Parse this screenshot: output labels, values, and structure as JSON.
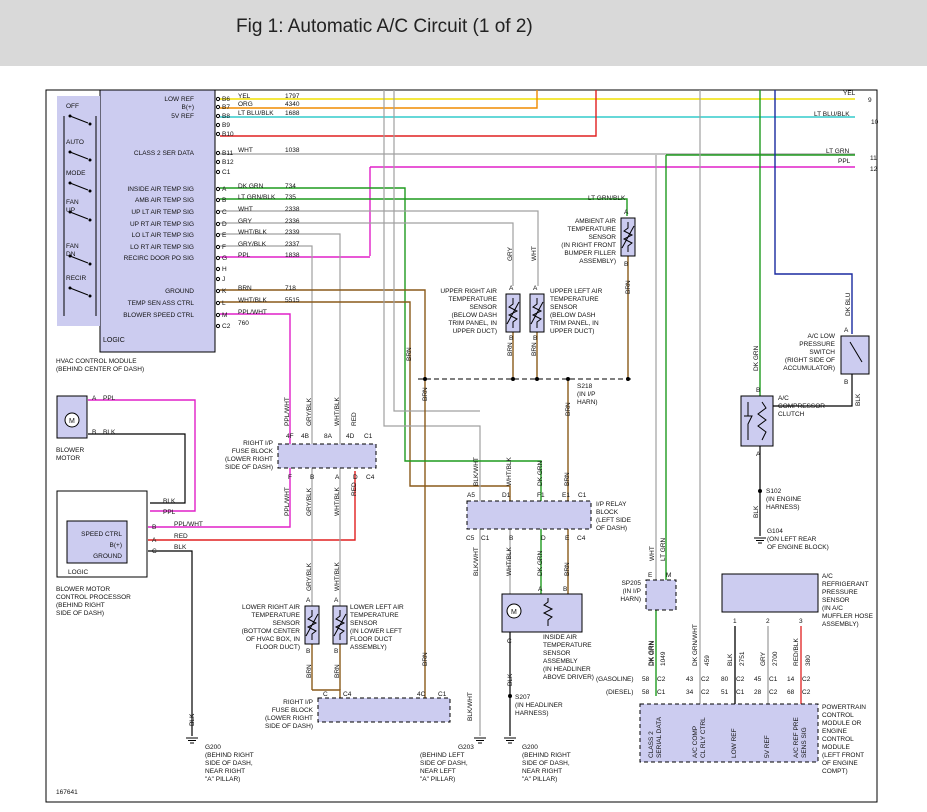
{
  "title": "Fig 1: Automatic A/C Circuit (1 of 2)",
  "figure_id": "167641",
  "hvac": {
    "name": "HVAC CONTROL MODULE",
    "location": "(BEHIND CENTER OF DASH)",
    "logic": "LOGIC",
    "switch_labels": [
      "OFF",
      "AUTO",
      "MODE",
      "FAN",
      "UP",
      "FAN",
      "DN",
      "RECIR"
    ],
    "rows": [
      {
        "label": "LOW REF",
        "pin": "B6",
        "wire": "YEL",
        "circuit": "1797"
      },
      {
        "label": "B(+)",
        "pin": "B7",
        "wire": "ORG",
        "circuit": "4340"
      },
      {
        "label": "5V REF",
        "pin": "B8",
        "wire": "LT BLU/BLK",
        "circuit": "1688"
      },
      {
        "label": "",
        "pin": "B9",
        "wire": "",
        "circuit": ""
      },
      {
        "label": "",
        "pin": "B10",
        "wire": "",
        "circuit": ""
      },
      {
        "label": "CLASS 2 SER DATA",
        "pin": "B11",
        "wire": "WHT",
        "circuit": "1038"
      },
      {
        "label": "",
        "pin": "B12",
        "wire": "",
        "circuit": ""
      },
      {
        "label": "",
        "pin": "C1",
        "wire": "",
        "circuit": ""
      },
      {
        "label": "INSIDE AIR TEMP SIG",
        "pin": "A",
        "wire": "DK GRN",
        "circuit": "734"
      },
      {
        "label": "AMB AIR TEMP SIG",
        "pin": "B",
        "wire": "LT GRN/BLK",
        "circuit": "735"
      },
      {
        "label": "UP LT AIR TEMP SIG",
        "pin": "C",
        "wire": "WHT",
        "circuit": "2338"
      },
      {
        "label": "UP RT AIR TEMP SIG",
        "pin": "D",
        "wire": "GRY",
        "circuit": "2336"
      },
      {
        "label": "LO LT AIR TEMP SIG",
        "pin": "E",
        "wire": "WHT/BLK",
        "circuit": "2339"
      },
      {
        "label": "LO RT AIR TEMP SIG",
        "pin": "F",
        "wire": "GRY/BLK",
        "circuit": "2337"
      },
      {
        "label": "RECIRC DOOR PO SIG",
        "pin": "G",
        "wire": "PPL",
        "circuit": "1838"
      },
      {
        "label": "",
        "pin": "H",
        "wire": "",
        "circuit": ""
      },
      {
        "label": "",
        "pin": "J",
        "wire": "",
        "circuit": ""
      },
      {
        "label": "GROUND",
        "pin": "K",
        "wire": "BRN",
        "circuit": "718"
      },
      {
        "label": "TEMP SEN ASS CTRL",
        "pin": "L",
        "wire": "WHT/BLK",
        "circuit": "5515"
      },
      {
        "label": "BLOWER SPEED CTRL",
        "pin": "M",
        "wire": "PPL/WHT",
        "circuit": ""
      },
      {
        "label": "",
        "pin": "C2",
        "wire": "760",
        "circuit": ""
      }
    ]
  },
  "right_edge": [
    {
      "wire": "YEL",
      "num": "9"
    },
    {
      "wire": "LT BLU/BLK",
      "num": "10"
    },
    {
      "wire": "LT GRN",
      "num": "11"
    },
    {
      "wire": "PPL",
      "num": "12"
    }
  ],
  "ambient": {
    "name": "AMBIENT AIR\nTEMPERATURE\nSENSOR\n(IN RIGHT FRONT\nBUMPER FILLER\nASSEMBLY)",
    "wire_top": "LT GRN/BLK",
    "pin_a": "A",
    "pin_b": "B",
    "wire_bottom": "BRN"
  },
  "upper_right": {
    "name": "UPPER RIGHT AIR\nTEMPERATURE\nSENSOR\n(BELOW DASH\nTRIM PANEL, IN\nUPPER DUCT)",
    "wire_top": "GRY",
    "wire_bottom": "BRN",
    "pin_a": "A",
    "pin_b": "B"
  },
  "upper_left": {
    "name": "UPPER LEFT AIR\nTEMPERATURE\nSENSOR\n(BELOW DASH\nTRIM PANEL, IN\nUPPER DUCT)",
    "wire_top": "WHT",
    "wire_bottom": "BRN",
    "pin_a": "A",
    "pin_b": "B"
  },
  "splice_s218": {
    "name": "S218",
    "loc": "(IN I/P\nHARN)",
    "wire": "BRN"
  },
  "blower_motor": {
    "name": "BLOWER\nMOTOR",
    "pin_a": "A",
    "pin_b": "B",
    "wire_a": "PPL",
    "wire_b": "BLK"
  },
  "bmcp": {
    "name": "BLOWER MOTOR\nCONTROL PROCESSOR\n(BEHIND RIGHT\nSIDE OF DASH)",
    "logic": "LOGIC",
    "speed": "SPEED CTRL",
    "bplus": "B(+)",
    "ground": "GROUND",
    "pin_speed": "B",
    "pin_bplus": "A",
    "pin_gnd": "C",
    "wire_speed": "PPL/WHT",
    "wire_bplus": "RED",
    "wire_gnd": "BLK",
    "wire_blk": "BLK",
    "wire_ppl": "PPL"
  },
  "fuse_block_top": {
    "name": "RIGHT I/P\nFUSE BLOCK\n(LOWER RIGHT\nSIDE OF DASH)",
    "pins_top": [
      "4F",
      "4B",
      "8A",
      "4D",
      "C1"
    ],
    "pins_bot": [
      "F",
      "B",
      "A",
      "D",
      "C4"
    ],
    "wires": [
      "PPL/WHT",
      "GRY/BLK",
      "WHT/BLK",
      "RED"
    ]
  },
  "fuse_block_bot": {
    "name": "RIGHT I/P\nFUSE BLOCK\n(LOWER RIGHT\nSIDE OF DASH)",
    "pins": [
      "C",
      "C4",
      "4C",
      "C1"
    ]
  },
  "relay_block": {
    "name": "I/P RELAY\nBLOCK\n(LEFT SIDE\nOF DASH)",
    "pins_top": [
      "A5",
      "D1",
      "F1",
      "E1",
      "C1"
    ],
    "pins_bot": [
      "C5",
      "C1",
      "B",
      "D",
      "E",
      "C4"
    ],
    "wires_top": [
      "BLK/WHT",
      "WHT/BLK",
      "DK GRN",
      "BRN"
    ],
    "wires_bot": [
      "BLK/WHT",
      "WHT/BLK",
      "DK GRN",
      "BRN"
    ]
  },
  "lower_right": {
    "name": "LOWER RIGHT AIR\nTEMPERATURE\nSENSOR\n(BOTTOM CENTER\nOF HVAC BOX, IN\nFLOOR DUCT)",
    "wire_top": "GRY/BLK",
    "wire_bottom": "BRN",
    "pin_a": "A",
    "pin_b": "B"
  },
  "lower_left": {
    "name": "LOWER LEFT AIR\nTEMPERATURE\nSENSOR\n(IN LOWER LEFT\nFLOOR DUCT\nASSEMBLY)",
    "wire_top": "WHT/BLK",
    "wire_bottom": "BRN",
    "pin_a": "A",
    "pin_b": "B"
  },
  "inside_sensor": {
    "name": "INSIDE AIR\nTEMPERATURE\nSENSOR\nASSEMBLY\n(IN HEADLINER\nABOVE DRIVER)",
    "pin_c": "C",
    "pin_a": "A",
    "pin_b": "B",
    "wire": "BLK"
  },
  "s207": {
    "name": "S207",
    "loc": "(IN HEADLINER\nHARNESS)",
    "wire": "BLK"
  },
  "grounds": [
    {
      "name": "G200",
      "loc": "(BEHIND RIGHT\nSIDE OF DASH,\nNEAR RIGHT\n\"A\" PILLAR)",
      "wire": "BLK"
    },
    {
      "name": "G203",
      "loc": "(BEHIND LEFT\nSIDE OF DASH,\nNEAR LEFT\n\"A\" PILLAR)",
      "wire": "BLK/WHT"
    },
    {
      "name": "G200",
      "loc": "(BEHIND RIGHT\nSIDE OF DASH,\nNEAR RIGHT\n\"A\" PILLAR)",
      "wire": "BLK"
    },
    {
      "name": "G104",
      "loc": "(ON LEFT REAR\nOF ENGINE BLOCK)",
      "wire": "BLK"
    }
  ],
  "sp205": {
    "name": "SP205",
    "loc": "(IN I/P\nHARN)",
    "pins": [
      "E",
      "M"
    ],
    "wires": [
      "WHT",
      "LT GRN"
    ]
  },
  "compressor": {
    "name": "A/C\nCOMPRESSOR\nCLUTCH",
    "pin_b": "B",
    "pin_a": "A",
    "wire_top": "DK GRN",
    "wire_bot": "BLK"
  },
  "s102": {
    "name": "S102",
    "loc": "(IN ENGINE\nHARNESS)"
  },
  "low_pressure": {
    "name": "A/C LOW\nPRESSURE\nSWITCH\n(RIGHT SIDE OF\nACCUMULATOR)",
    "pin_a": "A",
    "pin_b": "B",
    "wire_top": "DK BLU",
    "wire_bot": "BLK"
  },
  "refrig_sensor": {
    "name": "A/C\nREFRIGERANT\nPRESSURE\nSENSOR\n(IN A/C\nMUFFLER HOSE\nASSEMBLY)",
    "pins": [
      "1",
      "2",
      "3"
    ]
  },
  "pcm": {
    "name": "POWERTRAIN\nCONTROL\nMODULE OR\nENGINE\nCONTROL\nMODULE\n(LEFT FRONT\nOF ENGINE\nCOMPT)",
    "gasoline": "(GASOLINE)",
    "diesel": "(DIESEL)",
    "cols": [
      {
        "wire": "DK GRN",
        "circ": "1049",
        "gas": "58",
        "gas_c": "C2",
        "die": "58",
        "die_c": "C1",
        "label": "CLASS 2\nSERIAL DATA"
      },
      {
        "wire": "DK GRN/WHT",
        "circ": "459",
        "gas": "43",
        "gas_c": "C2",
        "die": "34",
        "die_c": "C2",
        "label": "A/C COMP\nCL RLY CTRL"
      },
      {
        "wire": "BLK",
        "circ": "2751",
        "gas": "80",
        "gas_c": "C2",
        "die": "51",
        "die_c": "C1",
        "label": "LOW REF"
      },
      {
        "wire": "GRY",
        "circ": "2700",
        "gas": "45",
        "gas_c": "C1",
        "die": "28",
        "die_c": "C2",
        "label": "5V REF"
      },
      {
        "wire": "RED/BLK",
        "circ": "380",
        "gas": "14",
        "gas_c": "C2",
        "die": "68",
        "die_c": "C2",
        "label": "A/C REF PRE\nSENS SIG"
      }
    ]
  },
  "colors": {
    "yellow": "#f0e000",
    "orange": "#f08c00",
    "cyan": "#33cccc",
    "green": "#1f9b1f",
    "magenta": "#e020c8",
    "red": "#e02020",
    "brown": "#8a5a1a",
    "blue": "#1a2aa0",
    "grey": "#a0a0a0",
    "black": "#000000"
  }
}
